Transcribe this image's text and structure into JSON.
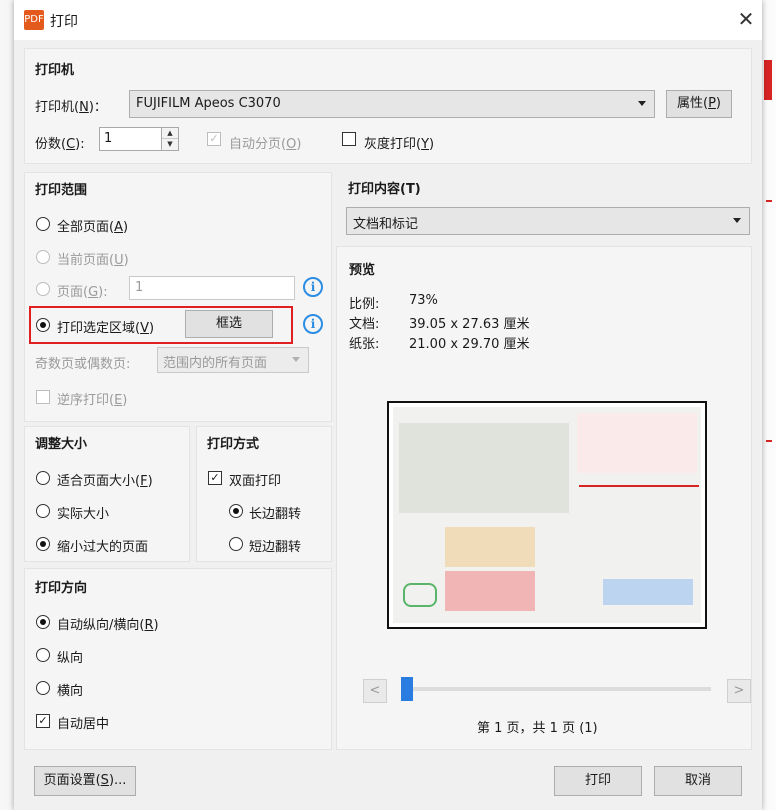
{
  "dialog": {
    "title": "打印",
    "close_glyph": "✕",
    "app_icon": "pdf-app-icon"
  },
  "printer": {
    "section": "打印机",
    "label_prefix": "打印机(",
    "label_key": "N",
    "label_suffix": ")：",
    "selected": "FUJIFILM Apeos C3070",
    "properties_prefix": "属性(",
    "properties_key": "P",
    "properties_suffix": ")",
    "copies_prefix": "份数(",
    "copies_key": "C",
    "copies_suffix": "):",
    "copies_value": "1",
    "collate_prefix": "自动分页(",
    "collate_key": "O",
    "collate_suffix": ")",
    "grayscale_prefix": "灰度打印(",
    "grayscale_key": "Y",
    "grayscale_suffix": ")"
  },
  "range": {
    "section": "打印范围",
    "all_prefix": "全部页面(",
    "all_key": "A",
    "all_suffix": ")",
    "current_prefix": "当前页面(",
    "current_key": "U",
    "current_suffix": ")",
    "pages_prefix": "页面(",
    "pages_key": "G",
    "pages_suffix": "):",
    "pages_value": "1",
    "selection_prefix": "打印选定区域(",
    "selection_key": "V",
    "selection_suffix": ")",
    "frame_button": "框选",
    "oddeven_label": "奇数页或偶数页:",
    "oddeven_value": "范围内的所有页面",
    "reverse_prefix": "逆序打印(",
    "reverse_key": "E",
    "reverse_suffix": ")",
    "highlight_color": "#e02020"
  },
  "content": {
    "section": "打印内容(T)",
    "value": "文档和标记"
  },
  "preview": {
    "section": "预览",
    "scale_label": "比例:",
    "scale_value": "73%",
    "doc_label": "文档:",
    "doc_value": "39.05 x 27.63 厘米",
    "paper_label": "纸张:",
    "paper_value": "21.00 x 29.70 厘米",
    "prev_glyph": "<",
    "next_glyph": ">",
    "page_status": "第 1 页，共 1 页 (1)",
    "slider_position": 0,
    "thumb_color": "#2b7ce0"
  },
  "resize": {
    "section": "调整大小",
    "fit_prefix": "适合页面大小(",
    "fit_key": "F",
    "fit_suffix": ")",
    "actual": "实际大小",
    "shrink": "缩小过大的页面"
  },
  "duplex": {
    "section": "打印方式",
    "two_sided": "双面打印",
    "long_edge": "长边翻转",
    "short_edge": "短边翻转"
  },
  "orientation": {
    "section": "打印方向",
    "auto_prefix": "自动纵向/横向(",
    "auto_key": "R",
    "auto_suffix": ")",
    "portrait": "纵向",
    "landscape": "横向",
    "center": "自动居中"
  },
  "footer": {
    "setup_prefix": "页面设置(",
    "setup_key": "S",
    "setup_suffix": ")...",
    "print": "打印",
    "cancel": "取消"
  }
}
